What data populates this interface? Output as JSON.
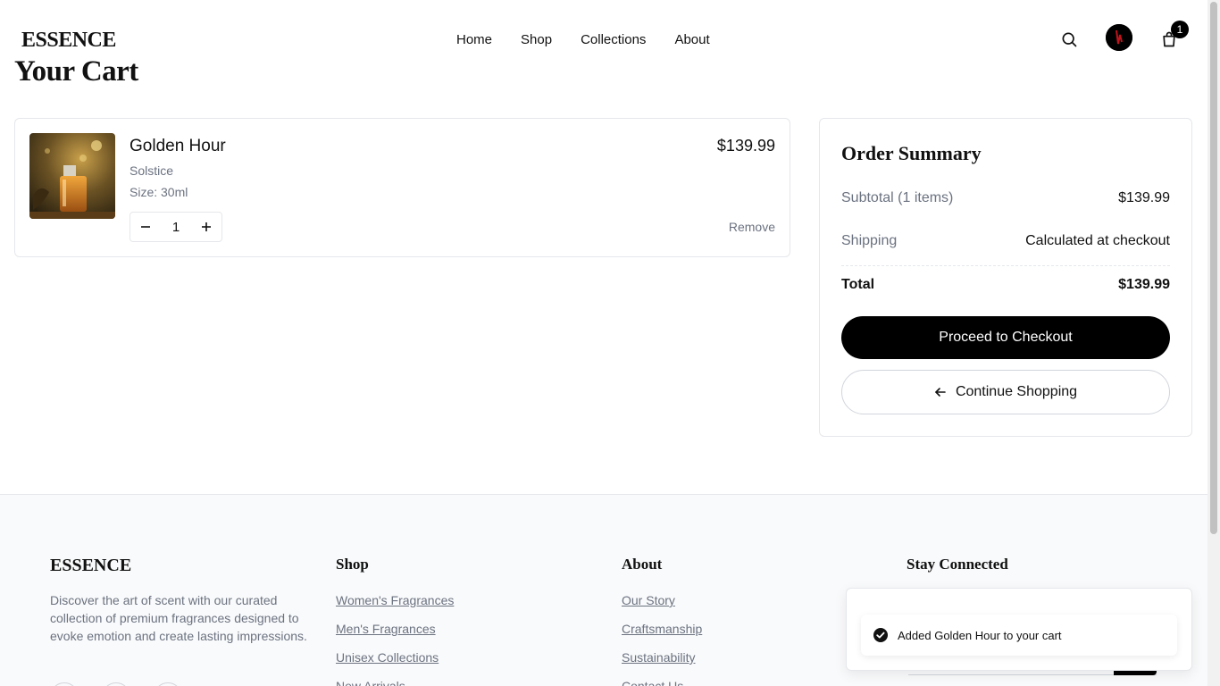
{
  "brand": "ESSENCE",
  "nav": {
    "items": [
      "Home",
      "Shop",
      "Collections",
      "About"
    ]
  },
  "header": {
    "cart_count": "1"
  },
  "page": {
    "title": "Your Cart"
  },
  "cart": {
    "item": {
      "name": "Golden Hour",
      "collection": "Solstice",
      "size": "Size: 30ml",
      "price": "$139.99",
      "quantity": "1",
      "remove_label": "Remove"
    }
  },
  "summary": {
    "title": "Order Summary",
    "subtotal_label": "Subtotal (1 items)",
    "subtotal_value": "$139.99",
    "shipping_label": "Shipping",
    "shipping_value": "Calculated at checkout",
    "total_label": "Total",
    "total_value": "$139.99",
    "checkout_label": "Proceed to Checkout",
    "continue_label": "Continue Shopping"
  },
  "footer": {
    "brand": "ESSENCE",
    "description": "Discover the art of scent with our curated collection of premium fragrances designed to evoke emotion and create lasting impressions.",
    "shop": {
      "heading": "Shop",
      "links": [
        "Women's Fragrances",
        "Men's Fragrances",
        "Unisex Collections",
        "New Arrivals"
      ]
    },
    "about": {
      "heading": "About",
      "links": [
        "Our Story",
        "Craftsmanship",
        "Sustainability",
        "Contact Us"
      ]
    },
    "connect": {
      "heading": "Stay Connected"
    }
  },
  "toast": {
    "message": "Added Golden Hour to your cart"
  },
  "colors": {
    "accent": "#000000",
    "muted_text": "#6b7280",
    "border": "#e5e7eb",
    "footer_bg": "#f9fafb"
  }
}
